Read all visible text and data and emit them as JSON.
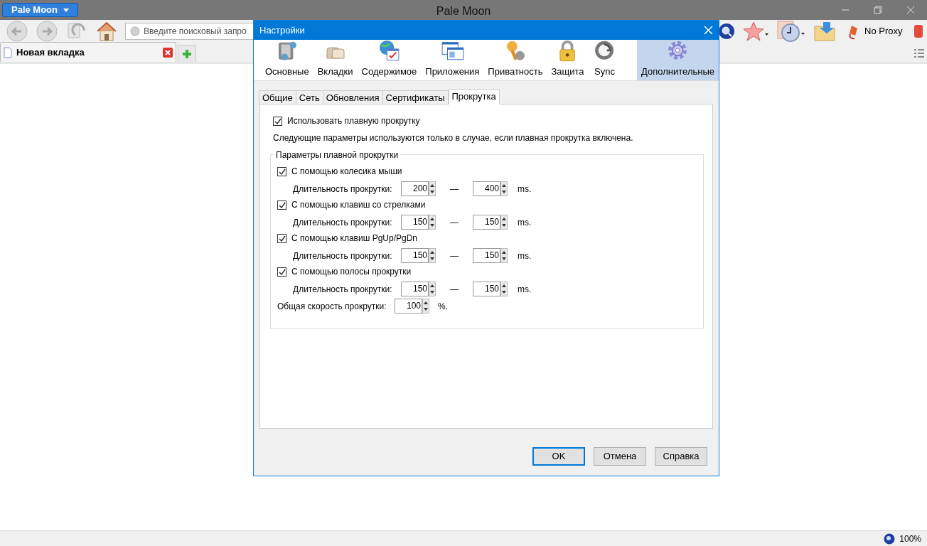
{
  "browser": {
    "title": "Pale Moon",
    "app_menu": "Pale Moon",
    "search_placeholder": "Введите поисковый запро",
    "proxy": "No Proxy",
    "tabs": [
      {
        "label": "Новая вкладка",
        "selected": true
      }
    ],
    "zoom": "100%"
  },
  "dialog": {
    "title": "Настройки",
    "categories": [
      {
        "label": "Основные",
        "selected": false
      },
      {
        "label": "Вкладки",
        "selected": false
      },
      {
        "label": "Содержимое",
        "selected": false
      },
      {
        "label": "Приложения",
        "selected": false
      },
      {
        "label": "Приватность",
        "selected": false
      },
      {
        "label": "Защита",
        "selected": false
      },
      {
        "label": "Sync",
        "selected": false
      },
      {
        "label": "Дополнительные",
        "selected": true
      }
    ],
    "subtabs": [
      {
        "label": "Общие",
        "selected": false
      },
      {
        "label": "Сеть",
        "selected": false
      },
      {
        "label": "Обновления",
        "selected": false
      },
      {
        "label": "Сертификаты",
        "selected": false
      },
      {
        "label": "Прокрутка",
        "selected": true
      }
    ],
    "smooth": {
      "label": "Использовать плавную прокрутку",
      "checked": true
    },
    "note": "Следующие параметры используются только в случае, если плавная прокрутка включена.",
    "group": {
      "legend": "Параметры плавной прокрутки",
      "rows": [
        {
          "label": "С помощью колесика мыши",
          "checked": true,
          "duration_label": "Длительность прокрутки:",
          "min": "200",
          "dash": "—",
          "max": "400",
          "unit": "ms."
        },
        {
          "label": "С помощью клавиш со стрелками",
          "checked": true,
          "duration_label": "Длительность прокрутки:",
          "min": "150",
          "dash": "—",
          "max": "150",
          "unit": "ms."
        },
        {
          "label": "С помощью клавиш PgUp/PgDn",
          "checked": true,
          "duration_label": "Длительность прокрутки:",
          "min": "150",
          "dash": "—",
          "max": "150",
          "unit": "ms."
        },
        {
          "label": "С помощью полосы прокрутки",
          "checked": true,
          "duration_label": "Длительность прокрутки:",
          "min": "150",
          "dash": "—",
          "max": "150",
          "unit": "ms."
        }
      ],
      "speed": {
        "label": "Общая скорость прокрутки:",
        "value": "100",
        "unit": "%."
      }
    },
    "buttons": [
      {
        "label": "OK",
        "default": true
      },
      {
        "label": "Отмена",
        "default": false
      },
      {
        "label": "Справка",
        "default": false
      }
    ]
  }
}
